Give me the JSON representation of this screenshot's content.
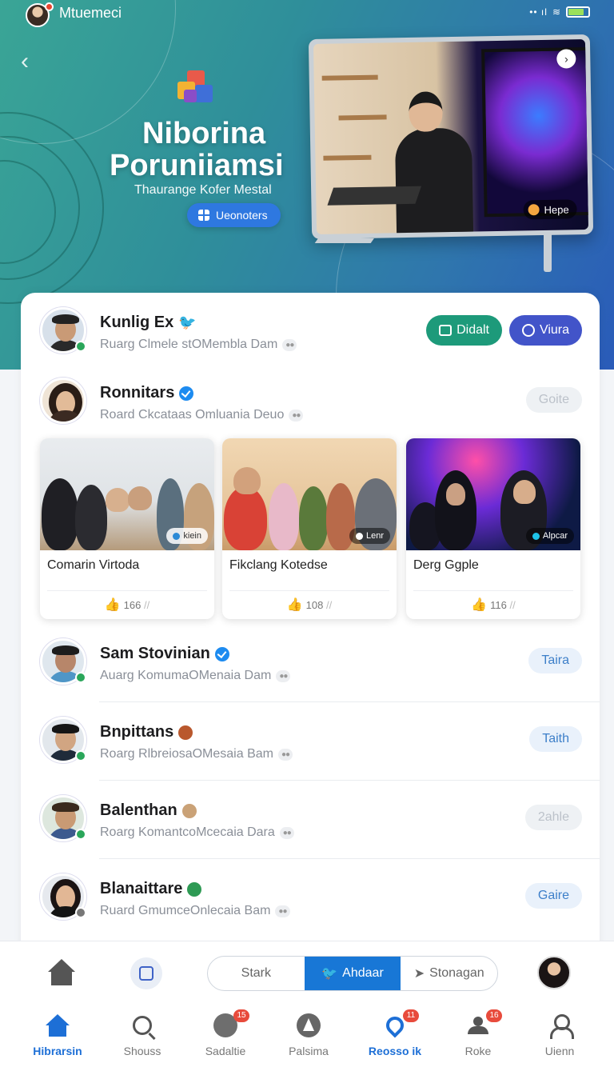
{
  "status_bar": {
    "username": "Mtuemeci",
    "signal": "•• ıl"
  },
  "hero": {
    "title_line1": "Niborina",
    "title_line2": "Poruniiamsi",
    "subtitle": "Thaurange Kofer Mestal",
    "button_label": "Ueonoters",
    "video_tag": "Hepe"
  },
  "people": [
    {
      "name": "Kunlig Ex",
      "subtitle": "Ruarg Clmele stOMembla Dam",
      "badge": "twitter",
      "actions": [
        "Didalt",
        "Viura"
      ]
    },
    {
      "name": "Ronnitars",
      "subtitle": "Roard Ckcataas Omluania Deuo",
      "badge": "verified",
      "action": "Goite"
    }
  ],
  "groups": [
    {
      "title": "Comarin Virtoda",
      "tag": "kiein",
      "likes": "166"
    },
    {
      "title": "Fikclang Kotedse",
      "tag": "Lenr",
      "likes": "108"
    },
    {
      "title": "Derg Ggple",
      "tag": "Alpcar",
      "likes": "116"
    }
  ],
  "more_people": [
    {
      "name": "Sam Stovinian",
      "subtitle": "Auarg KomumaOMenaia Dam",
      "action": "Taira"
    },
    {
      "name": "Bnpittans",
      "subtitle": "Roarg RlbreiosaOMesaia Bam",
      "action": "Taith"
    },
    {
      "name": "Balenthan",
      "subtitle": "Roarg KomantcoMcecaia Dara",
      "action": "2ahle"
    },
    {
      "name": "Blanaittare",
      "subtitle": "Ruard GmumceOnlecaia Bam",
      "action": "Gaire"
    }
  ],
  "segmented": {
    "left": "Stark",
    "middle": "Ahdaar",
    "right": "Stonagan"
  },
  "tabs": [
    {
      "label": "Hibrarsin",
      "badge": ""
    },
    {
      "label": "Shouss",
      "badge": ""
    },
    {
      "label": "Sadaltie",
      "badge": "15"
    },
    {
      "label": "Palsima",
      "badge": ""
    },
    {
      "label": "Reosso ik",
      "badge": "11"
    },
    {
      "label": "Roke",
      "badge": "16"
    },
    {
      "label": "Uienn",
      "badge": ""
    }
  ],
  "icons": [
    "back-arrow-icon",
    "app-cube-icon",
    "play-icon",
    "twitter-bird-icon",
    "verified-icon",
    "camera-icon",
    "chat-icon",
    "like-icon",
    "home-icon",
    "search-icon",
    "location-pin-icon",
    "users-icon",
    "user-icon"
  ],
  "colors": {
    "accent": "#1877d6",
    "green": "#1d9a7a",
    "purple": "#4254c9",
    "hero_start": "#3aa596",
    "hero_end": "#2a5bb9"
  }
}
